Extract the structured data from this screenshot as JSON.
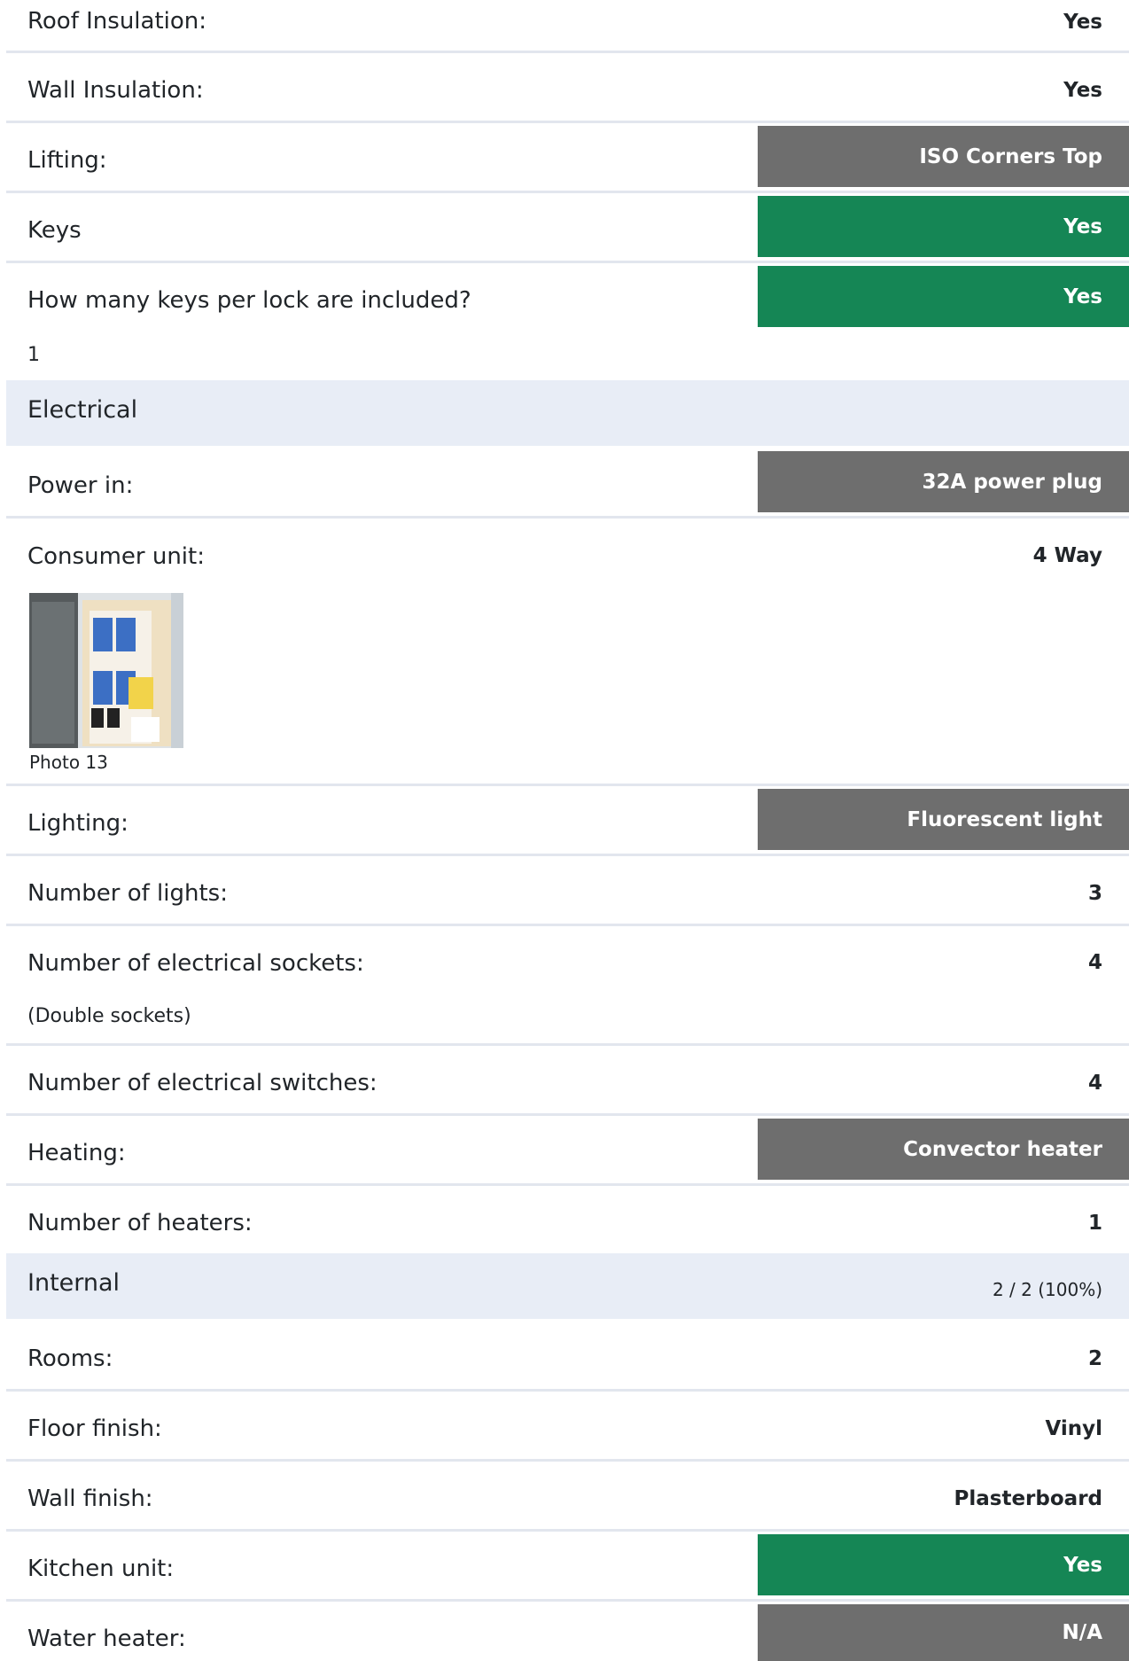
{
  "rows": {
    "roof_insulation": {
      "label": "Roof Insulation:",
      "value": "Yes"
    },
    "wall_insulation": {
      "label": "Wall Insulation:",
      "value": "Yes"
    },
    "lifting": {
      "label": "Lifting:",
      "value": "ISO Corners Top"
    },
    "keys": {
      "label": "Keys",
      "value": "Yes"
    },
    "keys_per_lock": {
      "label": "How many keys per lock are included?",
      "value": "Yes",
      "note": "1"
    },
    "power_in": {
      "label": "Power in:",
      "value": "32A power plug"
    },
    "consumer_unit": {
      "label": "Consumer unit:",
      "value": "4 Way",
      "photo_caption": "Photo 13"
    },
    "lighting": {
      "label": "Lighting:",
      "value": "Fluorescent light"
    },
    "number_of_lights": {
      "label": "Number of lights:",
      "value": "3"
    },
    "electrical_sockets": {
      "label": "Number of electrical sockets:",
      "value": "4",
      "note": "(Double sockets)"
    },
    "electrical_switches": {
      "label": "Number of electrical switches:",
      "value": "4"
    },
    "heating": {
      "label": "Heating:",
      "value": "Convector heater"
    },
    "number_of_heaters": {
      "label": "Number of heaters:",
      "value": "1"
    },
    "rooms": {
      "label": "Rooms:",
      "value": "2"
    },
    "floor_finish": {
      "label": "Floor finish:",
      "value": "Vinyl"
    },
    "wall_finish": {
      "label": "Wall finish:",
      "value": "Plasterboard"
    },
    "kitchen_unit": {
      "label": "Kitchen unit:",
      "value": "Yes"
    },
    "water_heater": {
      "label": "Water heater:",
      "value": "N/A"
    }
  },
  "sections": {
    "electrical": {
      "title": "Electrical"
    },
    "internal": {
      "title": "Internal",
      "progress": "2 / 2 (100%)"
    }
  },
  "colors": {
    "badge_gray": "#6e6e6e",
    "badge_green": "#158655",
    "section_bg": "#e8edf6",
    "divider": "#e2e6ee"
  }
}
